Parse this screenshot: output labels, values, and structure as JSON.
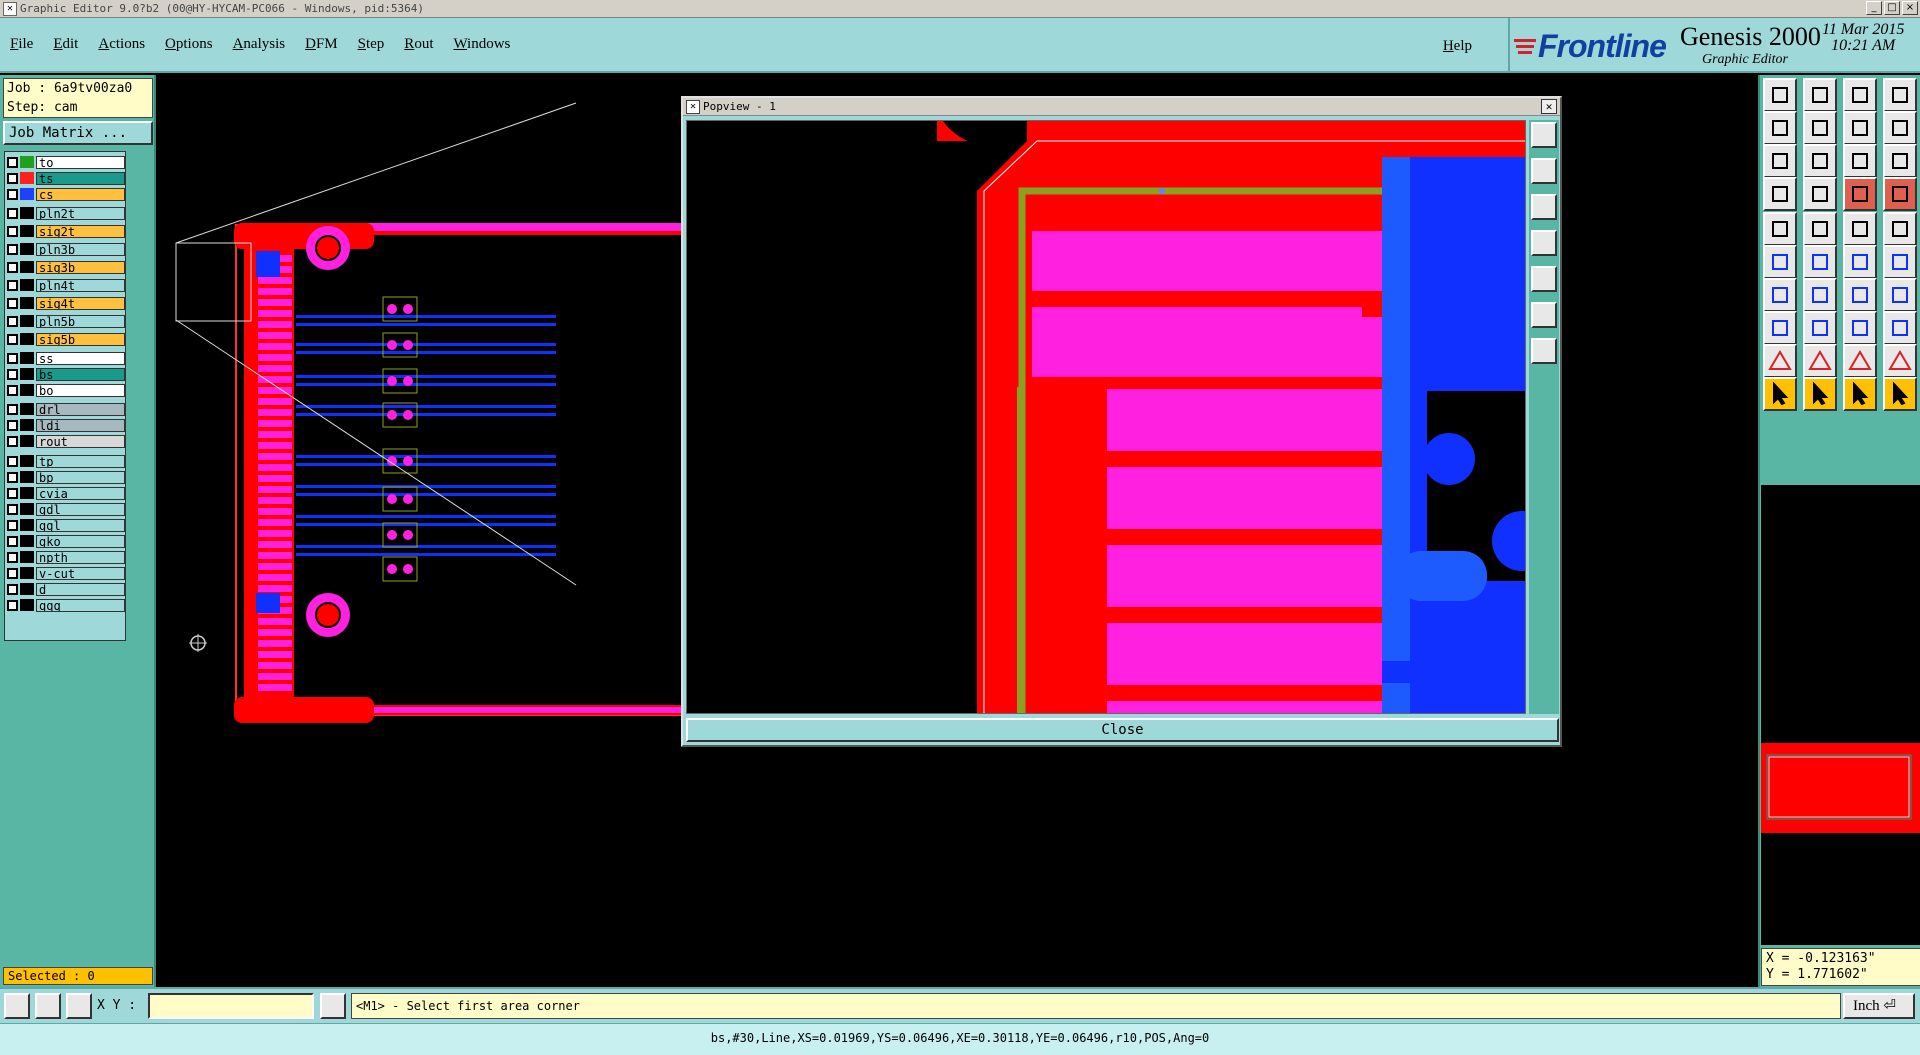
{
  "window": {
    "title": "Graphic Editor 9.0?b2 (00@HY-HYCAM-PC066 - Windows, pid:5364)",
    "controls": [
      "_",
      "□",
      "×"
    ]
  },
  "menubar": {
    "items": [
      "File",
      "Edit",
      "Actions",
      "Options",
      "Analysis",
      "DFM",
      "Step",
      "Rout",
      "Windows"
    ],
    "help": "Help"
  },
  "brand": {
    "logo": "Frontline",
    "product": "Genesis 2000",
    "subtitle": "Graphic Editor",
    "date": "11 Mar 2015",
    "time": "10:21 AM"
  },
  "job": {
    "job_line": "Job : 6a9tv00za0",
    "step_line": "Step: cam",
    "matrix_button": "Job Matrix ..."
  },
  "layers": [
    {
      "name": "to",
      "swatch": "#20a020",
      "bg": "#ffffff"
    },
    {
      "name": "ts",
      "swatch": "#ff2020",
      "bg": "#1a9a8a"
    },
    {
      "name": "cs",
      "swatch": "#2040ff",
      "bg": "#ffc040"
    },
    {
      "name": "pln2t",
      "swatch": "",
      "bg": "#9fd8d8"
    },
    {
      "name": "sig2t",
      "swatch": "",
      "bg": "#ffc040"
    },
    {
      "name": "pln3b",
      "swatch": "",
      "bg": "#9fd8d8"
    },
    {
      "name": "sig3b",
      "swatch": "",
      "bg": "#ffc040"
    },
    {
      "name": "pln4t",
      "swatch": "",
      "bg": "#9fd8d8"
    },
    {
      "name": "sig4t",
      "swatch": "",
      "bg": "#ffc040"
    },
    {
      "name": "pln5b",
      "swatch": "",
      "bg": "#9fd8d8"
    },
    {
      "name": "sig5b",
      "swatch": "",
      "bg": "#ffc040"
    },
    {
      "name": "ss",
      "swatch": "",
      "bg": "#ffffff"
    },
    {
      "name": "bs",
      "swatch": "",
      "bg": "#1a9a8a"
    },
    {
      "name": "bo",
      "swatch": "",
      "bg": "#ffffff"
    },
    {
      "name": "drl",
      "swatch": "",
      "bg": "#a8b8c0"
    },
    {
      "name": "ldi",
      "swatch": "",
      "bg": "#a8b8c0"
    },
    {
      "name": "rout",
      "swatch": "",
      "bg": "#d8d8d8"
    },
    {
      "name": "tp",
      "swatch": "",
      "bg": "#9fd8d8"
    },
    {
      "name": "bp",
      "swatch": "",
      "bg": "#9fd8d8"
    },
    {
      "name": "cvia",
      "swatch": "",
      "bg": "#9fd8d8"
    },
    {
      "name": "gdl",
      "swatch": "",
      "bg": "#9fd8d8"
    },
    {
      "name": "ggl",
      "swatch": "",
      "bg": "#9fd8d8"
    },
    {
      "name": "gko",
      "swatch": "",
      "bg": "#9fd8d8"
    },
    {
      "name": "npth",
      "swatch": "",
      "bg": "#9fd8d8"
    },
    {
      "name": "v-cut",
      "swatch": "",
      "bg": "#9fd8d8"
    },
    {
      "name": "d",
      "swatch": "",
      "bg": "#9fd8d8"
    },
    {
      "name": "qqq",
      "swatch": "",
      "bg": "#9fd8d8"
    }
  ],
  "selected": "Selected : 0",
  "popview": {
    "title": "Popview - 1",
    "close": "Close"
  },
  "coords": {
    "x": "X = -0.123163\"",
    "y": "Y = 1.771602\""
  },
  "bottombar": {
    "xy_label": "X Y :",
    "xy_value": "",
    "prompt": "<M1> - Select first area corner",
    "unit": "Inch"
  },
  "status": "bs,#30,Line,XS=0.01969,YS=0.06496,XE=0.30118,YE=0.06496,r10,POS,Ang=0",
  "colors": {
    "top_copper": "#ff0000",
    "bottom_copper": "#1030ff",
    "pads": "#ff20e0",
    "outline": "#90a020",
    "panel": "#9fd8d8"
  }
}
